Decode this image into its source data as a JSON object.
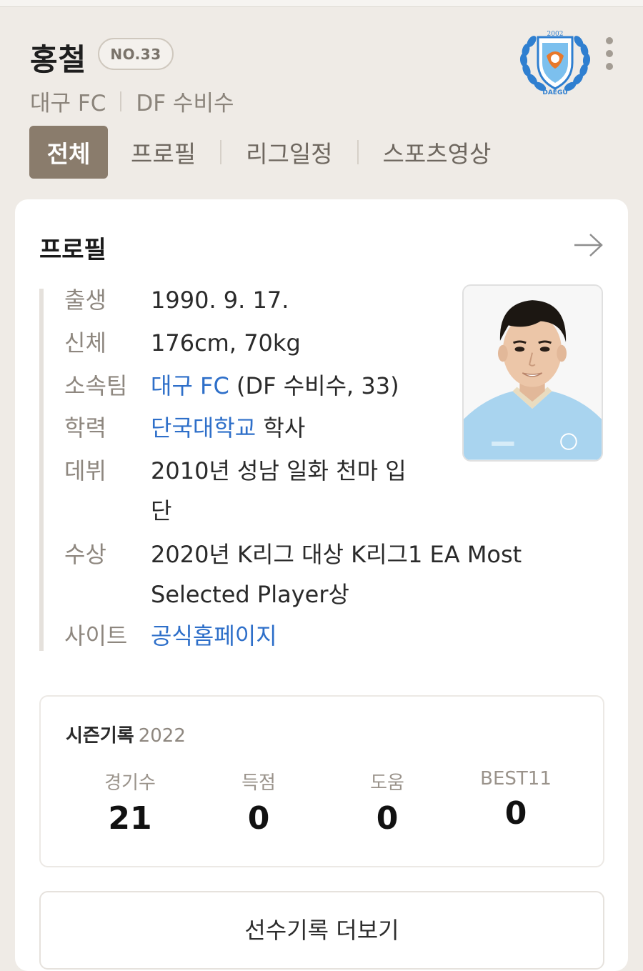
{
  "header": {
    "player_name": "홍철",
    "number_badge": "NO.33",
    "team": "대구 FC",
    "position": "DF 수비수",
    "logo_text": "DAEGU",
    "logo_year": "2002"
  },
  "tabs": [
    {
      "label": "전체",
      "active": true
    },
    {
      "label": "프로필",
      "active": false
    },
    {
      "label": "리그일정",
      "active": false
    },
    {
      "label": "스포츠영상",
      "active": false
    }
  ],
  "profile": {
    "title": "프로필",
    "rows": {
      "birth": {
        "label": "출생",
        "value": "1990. 9. 17."
      },
      "body": {
        "label": "신체",
        "value": "176cm, 70kg"
      },
      "team": {
        "label": "소속팀",
        "link": "대구 FC",
        "value": " (DF 수비수, 33)"
      },
      "education": {
        "label": "학력",
        "link": "단국대학교",
        "value": " 학사"
      },
      "debut": {
        "label": "데뷔",
        "value_line1": "2010년 성남 일화 천마 입",
        "value_line2": "단"
      },
      "award": {
        "label": "수상",
        "value_line1": "2020년 K리그 대상 K리그1 EA Most",
        "value_line2": "Selected Player상"
      },
      "site": {
        "label": "사이트",
        "link": "공식홈페이지"
      }
    }
  },
  "season": {
    "title": "시즌기록",
    "year": "2022",
    "stats": [
      {
        "label": "경기수",
        "value": "21"
      },
      {
        "label": "득점",
        "value": "0"
      },
      {
        "label": "도움",
        "value": "0"
      },
      {
        "label": "BEST11",
        "value": "0"
      }
    ]
  },
  "more_button": "선수기록 더보기",
  "colors": {
    "background": "#efebe6",
    "active_tab": "#8a7c6c",
    "link": "#2e6fc9",
    "logo_blue": "#2f7fd0",
    "logo_orange": "#e8782a",
    "jersey": "#a9d4ef"
  },
  "icons": {
    "more": "vertical-dots-icon",
    "arrow": "arrow-right-icon"
  }
}
